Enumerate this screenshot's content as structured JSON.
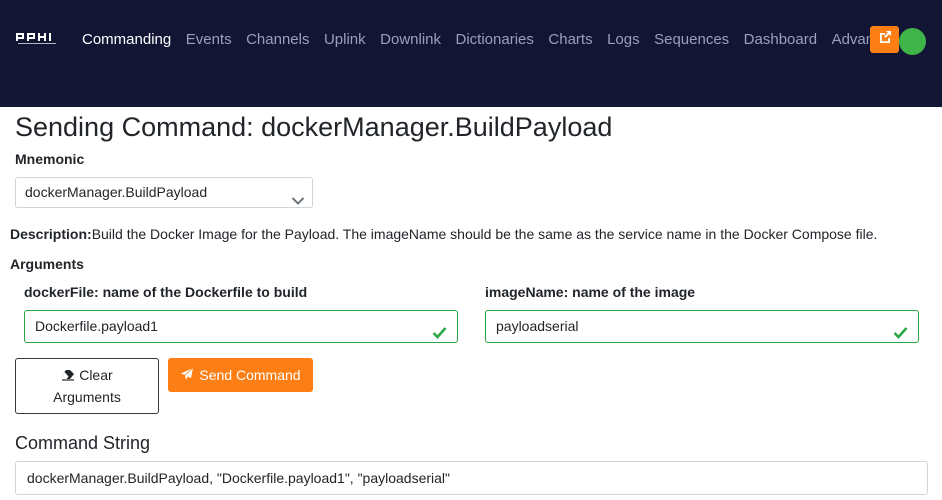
{
  "nav": {
    "items": [
      {
        "label": "Commanding",
        "active": true
      },
      {
        "label": "Events"
      },
      {
        "label": "Channels"
      },
      {
        "label": "Uplink"
      },
      {
        "label": "Downlink"
      },
      {
        "label": "Dictionaries"
      },
      {
        "label": "Charts"
      },
      {
        "label": "Logs"
      },
      {
        "label": "Sequences"
      },
      {
        "label": "Dashboard"
      },
      {
        "label": "Advanced"
      }
    ],
    "external_icon": "external-link-icon",
    "status_color": "#3fb549"
  },
  "page": {
    "title": "Sending Command: dockerManager.BuildPayload"
  },
  "mnemonic": {
    "label": "Mnemonic",
    "selected": "dockerManager.BuildPayload"
  },
  "description": {
    "label": "Description:",
    "text": "Build the Docker Image for the Payload. The imageName should be the same as the service name in the Docker Compose file."
  },
  "arguments": {
    "label": "Arguments",
    "fields": [
      {
        "label": "dockerFile: name of the Dockerfile to build",
        "value": "Dockerfile.payload1"
      },
      {
        "label": "imageName: name of the image",
        "value": "payloadserial"
      }
    ]
  },
  "buttons": {
    "clear_line1": "Clear",
    "clear_line2": "Arguments",
    "send": "Send Command"
  },
  "command_string": {
    "label": "Command String",
    "value": "dockerManager.BuildPayload, \"Dockerfile.payload1\", \"payloadserial\""
  },
  "colors": {
    "navbar": "#121533",
    "accent": "#fd7e14",
    "valid": "#28a745"
  }
}
